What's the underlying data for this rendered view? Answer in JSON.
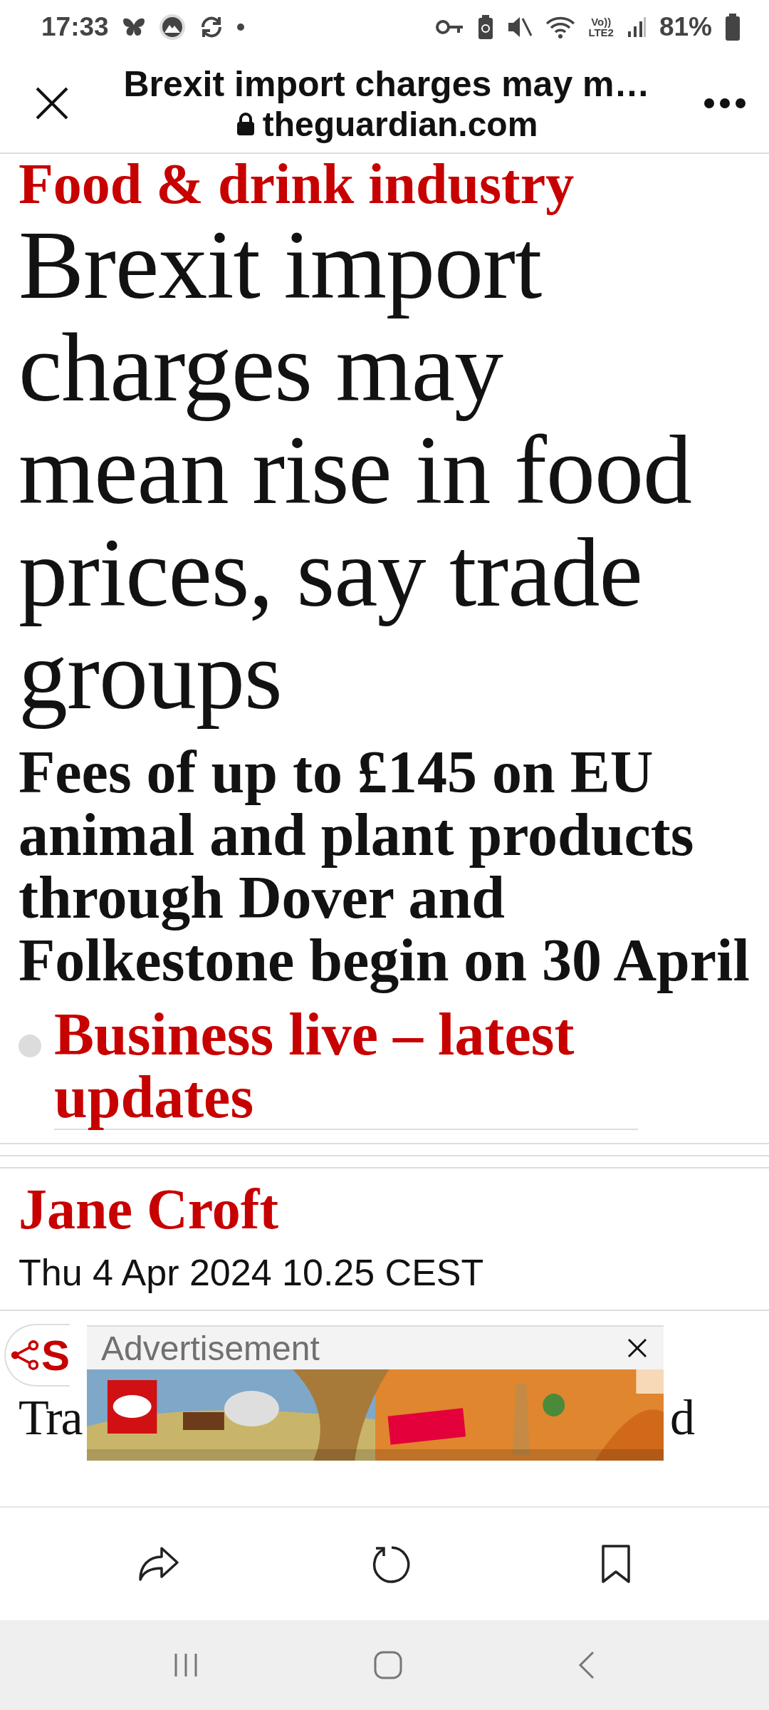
{
  "status_bar": {
    "time": "17:33",
    "network": "Vo))\nLTE2",
    "battery": "81%"
  },
  "toolbar": {
    "title": "Brexit import charges may m…",
    "domain": "theguardian.com"
  },
  "article": {
    "kicker": "Food & drink industry",
    "headline": "Brexit import charges may mean rise in food prices, say trade groups",
    "standfirst": "Fees of up to £145 on EU animal and plant products through Dover and Folkestone begin on 30 April",
    "live_link": "Business live – latest updates",
    "author": "Jane Croft",
    "date": "Thu 4 Apr 2024 10.25 CEST",
    "share_label": "S",
    "body_start": "Tra",
    "body_end": "d"
  },
  "ad": {
    "label": "Advertisement"
  }
}
